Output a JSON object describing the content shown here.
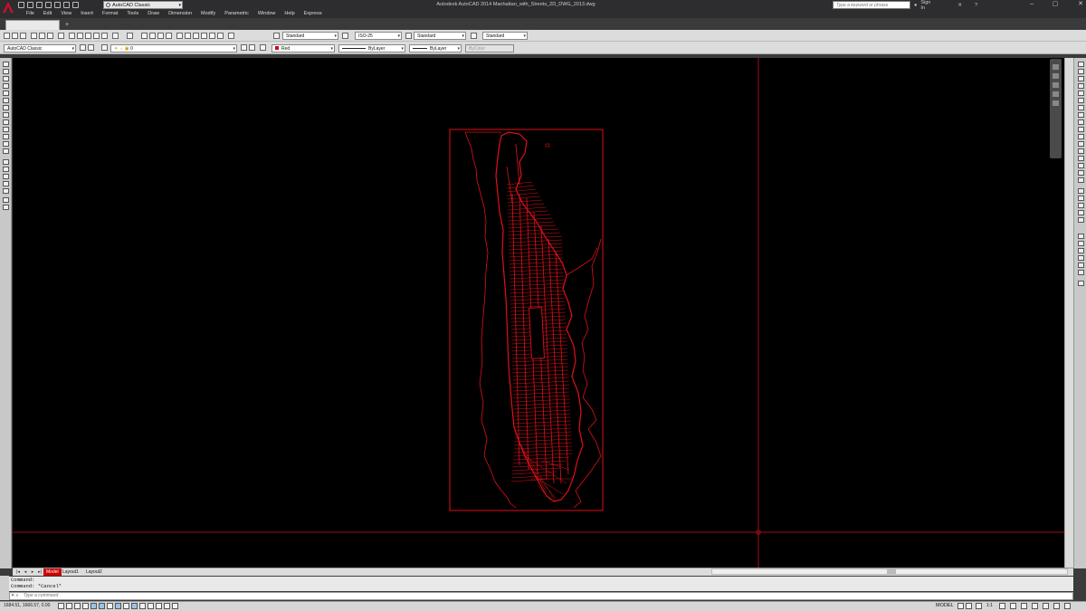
{
  "window": {
    "title": "Autodesk AutoCAD 2014   Manhattan_with_Streets_2D_DWG_2013.dwg",
    "workspace": "AutoCAD Classic",
    "search_placeholder": "Type a keyword or phrase",
    "signin": "Sign In",
    "min": "–",
    "max": "▢",
    "close": "✕",
    "help": "?"
  },
  "menu": [
    "File",
    "Edit",
    "View",
    "Insert",
    "Format",
    "Tools",
    "Draw",
    "Dimension",
    "Modify",
    "Parametric",
    "Window",
    "Help",
    "Express"
  ],
  "styles": {
    "text_style": "Standard",
    "dim_style": "ISO-25",
    "table_style": "Standard",
    "mleader_style": "Standard"
  },
  "layers": {
    "workspace": "AutoCAD Classic",
    "current_layer": "0",
    "color": "Red",
    "linetype": "ByLayer",
    "lineweight": "ByLayer",
    "plotstyle": "ByColor"
  },
  "layout_tabs": [
    "Model",
    "Layout1",
    "Layout2"
  ],
  "command": {
    "line1": "Command:",
    "line2": "Command: *Cancel*",
    "placeholder": "Type a command"
  },
  "status": {
    "coords": "1684.51, 1666.57, 0.00",
    "model": "MODEL",
    "scale": "1:1"
  },
  "colors": {
    "canvas": "#000000",
    "drawing": "#e0101a",
    "ui_dark": "#2d2d30",
    "toolbar": "#dcdcdc"
  }
}
